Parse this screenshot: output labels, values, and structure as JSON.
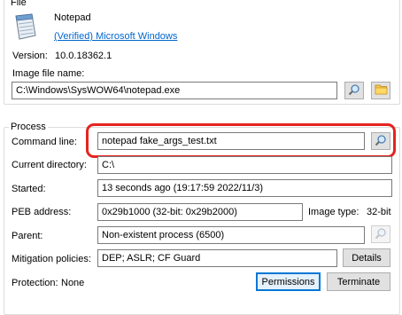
{
  "file_group": {
    "label": "File",
    "app_name": "Notepad",
    "verified_link": "(Verified) Microsoft Windows",
    "version_label": "Version:",
    "version_value": "10.0.18362.1",
    "image_file_label": "Image file name:",
    "image_file_value": "C:\\Windows\\SysWOW64\\notepad.exe"
  },
  "process_group": {
    "label": "Process",
    "command_line_label": "Command line:",
    "command_line_value": "notepad fake_args_test.txt",
    "current_dir_label": "Current directory:",
    "current_dir_value": "C:\\",
    "started_label": "Started:",
    "started_value": "13 seconds ago (19:17:59 2022/11/3)",
    "peb_label": "PEB address:",
    "peb_value": "0x29b1000 (32-bit: 0x29b2000)",
    "image_type_label": "Image type:",
    "image_type_value": "32-bit",
    "parent_label": "Parent:",
    "parent_value": "Non-existent process (6500)",
    "mitigation_label": "Mitigation policies:",
    "mitigation_value": "DEP; ASLR; CF Guard",
    "details_button": "Details",
    "protection_label": "Protection:",
    "protection_value": "None",
    "permissions_button": "Permissions",
    "terminate_button": "Terminate"
  },
  "icons": {
    "app": "notepad-icon",
    "search": "magnifier-icon",
    "folder": "folder-icon"
  },
  "colors": {
    "link": "#0066cc",
    "highlight": "#e52420",
    "focus": "#0078d7"
  }
}
